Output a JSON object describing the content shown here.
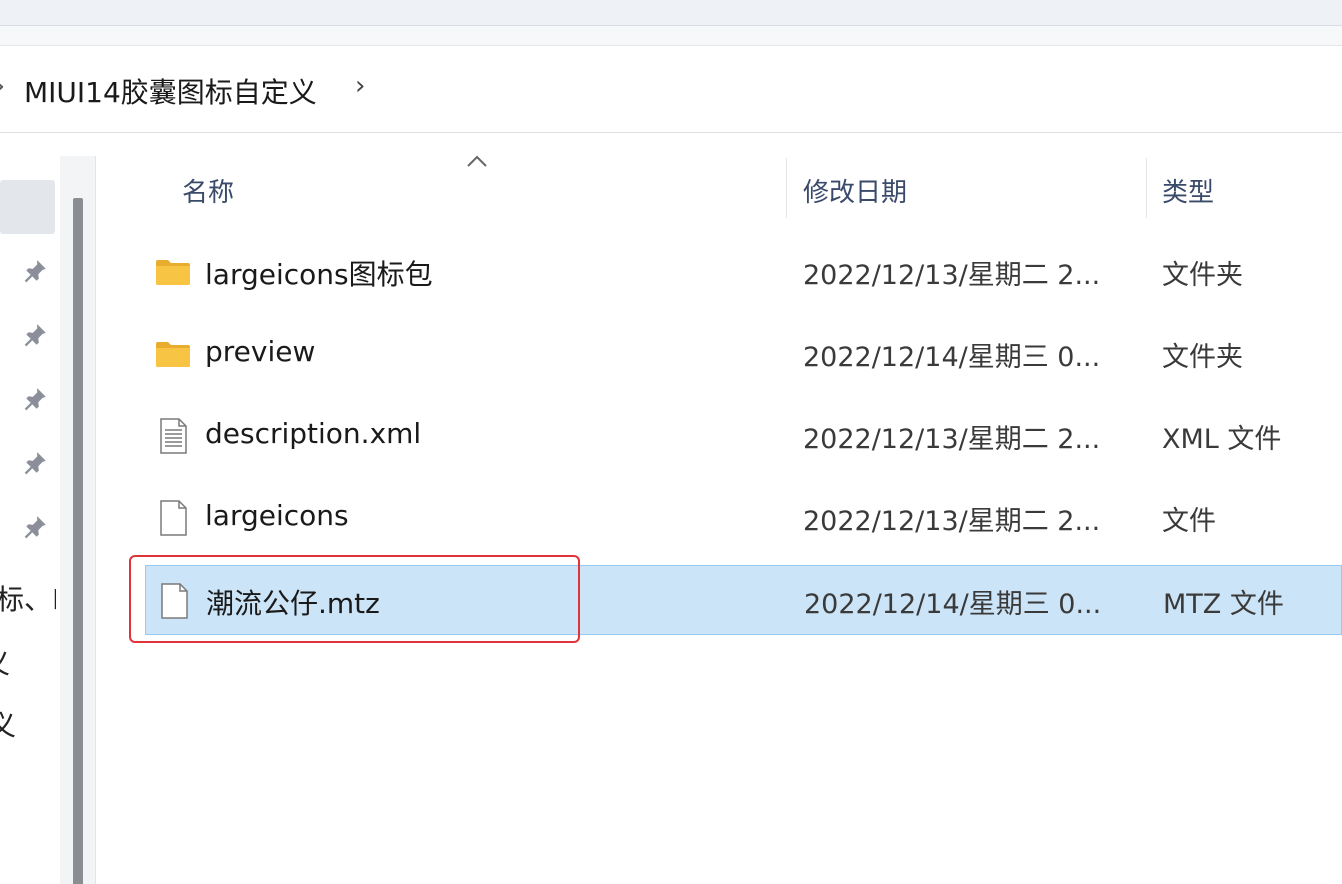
{
  "breadcrumb": {
    "path": "MIUI14胶囊图标自定义",
    "chevron": "›"
  },
  "nav": {
    "pins": [
      "pin-icon",
      "pin-icon",
      "pin-icon",
      "pin-icon",
      "pin-icon"
    ],
    "partial_labels": [
      "标、I",
      "义",
      "义"
    ]
  },
  "columns": {
    "name": "名称",
    "date": "修改日期",
    "type": "类型"
  },
  "files": [
    {
      "name": "largeicons图标包",
      "date": "2022/12/13/星期二 2...",
      "type": "文件夹",
      "icon": "folder-icon"
    },
    {
      "name": "preview",
      "date": "2022/12/14/星期三 0...",
      "type": "文件夹",
      "icon": "folder-icon"
    },
    {
      "name": "description.xml",
      "date": "2022/12/13/星期二 2...",
      "type": "XML 文件",
      "icon": "xml-file-icon"
    },
    {
      "name": "largeicons",
      "date": "2022/12/13/星期二 2...",
      "type": "文件",
      "icon": "file-icon"
    },
    {
      "name": "潮流公仔.mtz",
      "date": "2022/12/14/星期三 0...",
      "type": "MTZ 文件",
      "icon": "file-icon",
      "selected": true
    }
  ],
  "colors": {
    "selection_bg": "#cce4f7",
    "selection_border": "#99c9ef",
    "highlight": "#e0343a",
    "folder": "#f7c443"
  }
}
